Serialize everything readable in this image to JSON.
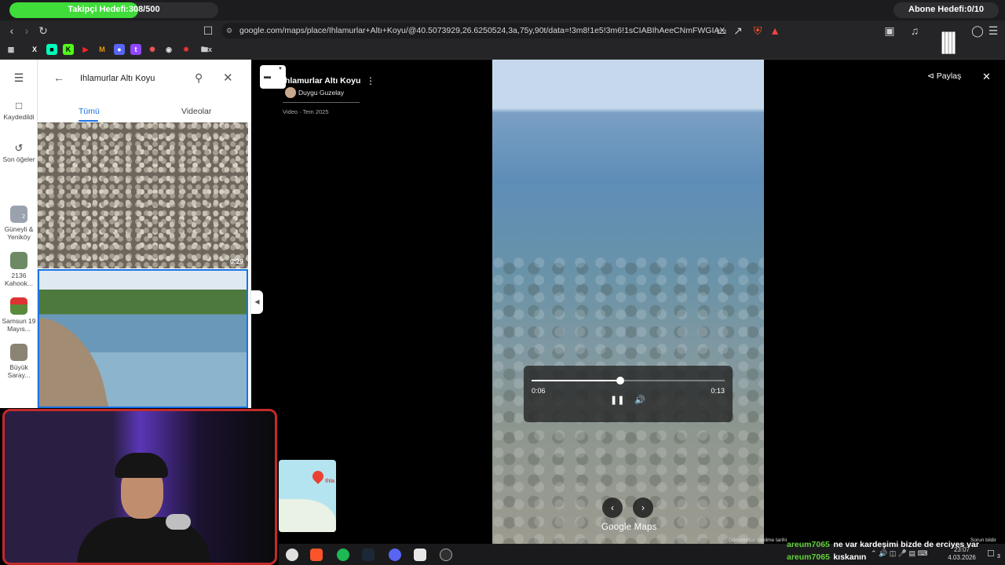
{
  "overlay": {
    "follower_goal": {
      "label": "Takipçi Hedefi:308/500",
      "fraction": 0.616,
      "color": "#3fdc3a"
    },
    "sub_goal": {
      "label": "Abone Hedefi:0/10",
      "fraction": 0.0
    }
  },
  "browser": {
    "url": "google.com/maps/place/Ihlamurlar+Altı+Koyu/@40.5073929,26.6250524,3a,75y,90t/data=!3m8!1e5!3m6!1sCIABIhAeeCNmFWGIAXbdka3SUnu...",
    "bookmarks": [
      "x-icon",
      "app-icon",
      "kick-icon",
      "youtube-icon",
      "app-icon",
      "discord-icon",
      "twitch-icon",
      "app-icon",
      "app-icon",
      "app-icon",
      "folder-icon"
    ]
  },
  "rail": {
    "saved": "Kaydedildi",
    "recent": "Son öğeler",
    "recent_items": [
      "Güneyli & Yeniköy",
      "2136 Kahook...",
      "Samsun 19 Mayıs...",
      "Büyük Saray..."
    ],
    "badge_count": "2"
  },
  "panel": {
    "search_value": "Ihlamurlar Altı Koyu",
    "tabs": [
      "Tümü",
      "Videolar"
    ],
    "active_tab": "Tümü",
    "media": [
      {
        "type": "video",
        "duration": "0:29"
      },
      {
        "type": "photo",
        "duration": ""
      }
    ]
  },
  "video": {
    "title": "Ihlamurlar Altı Koyu",
    "author": "Duygu Guzelay",
    "meta": "Video · Tem 2025",
    "current_time": "0:06",
    "total_time": "0:13",
    "progress": 0.46,
    "share_label": "Paylaş",
    "brand": "Google Maps"
  },
  "mini_map": {
    "label": "Ihla"
  },
  "chat": [
    {
      "user": "areum7065",
      "message": "ne var kardeşimi bizde de erciyes var"
    },
    {
      "user": "areum7065",
      "message": "kıskanın"
    }
  ],
  "footer_note": "Görüntünün çekilme tarihi",
  "report_label": "Sorun bildir",
  "clock": {
    "time": "23:07",
    "date": "4.03.2026"
  },
  "notif_count": "3"
}
